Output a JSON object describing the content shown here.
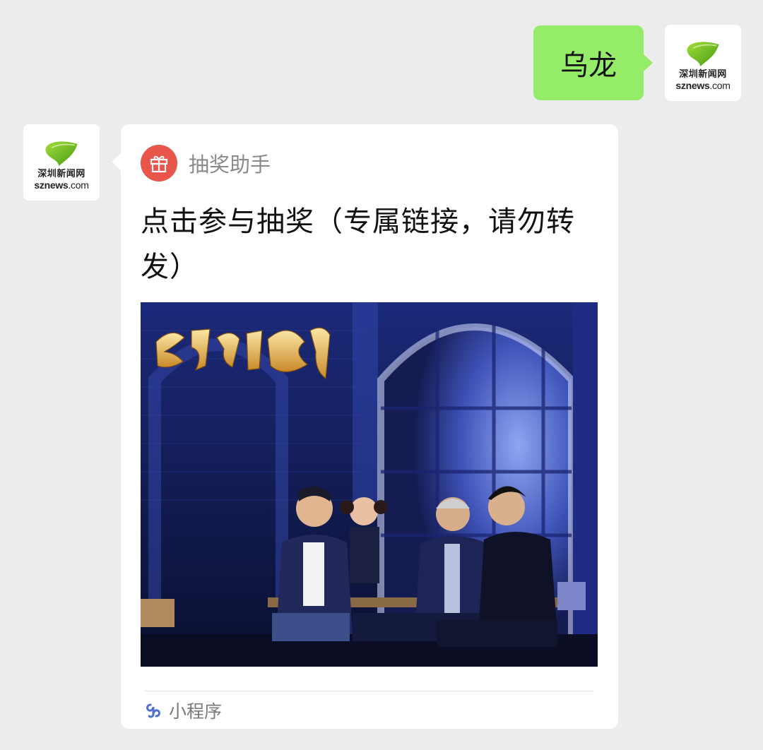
{
  "chat": {
    "outgoing_message": {
      "text": "乌龙"
    },
    "sender_avatar": {
      "brand_cn": "深圳新闻网",
      "brand_en_bold": "sznews",
      "brand_en_thin": ".com"
    },
    "contact_avatar": {
      "brand_cn": "深圳新闻网",
      "brand_en_bold": "sznews",
      "brand_en_thin": ".com"
    },
    "mini_program_card": {
      "app_name": "抽奖助手",
      "app_icon": "gift-icon",
      "title": "点击参与抽奖（专属链接，请勿转发）",
      "poster_title_art": "乌龙山伯爵",
      "footer_icon": "mini-program-icon",
      "footer_label": "小程序"
    }
  },
  "colors": {
    "background": "#ececec",
    "outgoing_bubble": "#95ec69",
    "gift_icon_bg": "#e8554a",
    "leaf_green": "#5fb81f",
    "mini_program_icon": "#4c6fd1"
  }
}
